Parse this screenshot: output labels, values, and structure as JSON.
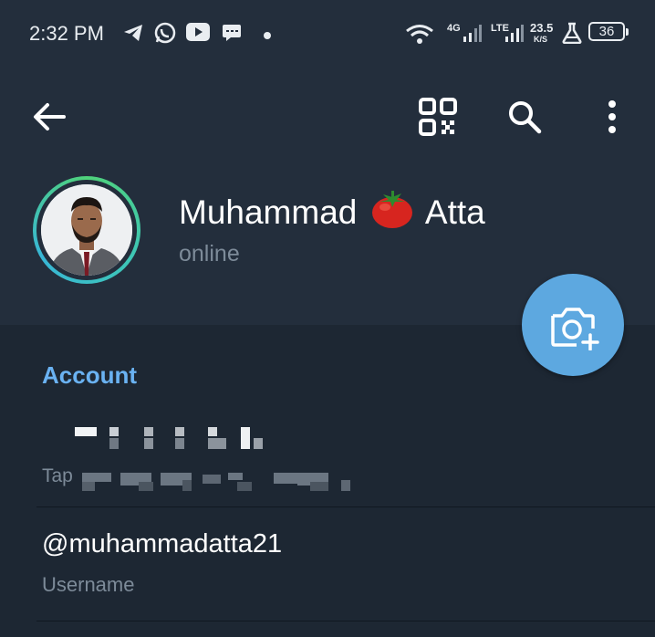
{
  "status_bar": {
    "time": "2:32 PM",
    "network_4g": "4G",
    "network_lte": "LTE",
    "speed_value": "23.5",
    "speed_unit": "K/S",
    "battery": "36"
  },
  "profile": {
    "name_first": "Muhammad",
    "name_emoji": "tomato",
    "name_last": "Atta",
    "status": "online"
  },
  "account": {
    "section_title": "Account",
    "phone_hint_prefix": "Tap",
    "username_value": "@muhammadatta21",
    "username_label": "Username"
  },
  "colors": {
    "header_bg": "#232e3c",
    "page_bg": "#1d2733",
    "accent": "#6ab2f2",
    "fab": "#5da8e0",
    "secondary_text": "#7d8b99",
    "avatar_ring": "#4fd27a"
  },
  "icons": [
    "telegram-icon",
    "whatsapp-icon",
    "youtube-icon",
    "message-icon",
    "wifi-icon",
    "signal-icon",
    "flask-icon",
    "back-arrow-icon",
    "qr-code-icon",
    "search-icon",
    "more-vertical-icon",
    "camera-add-icon"
  ]
}
